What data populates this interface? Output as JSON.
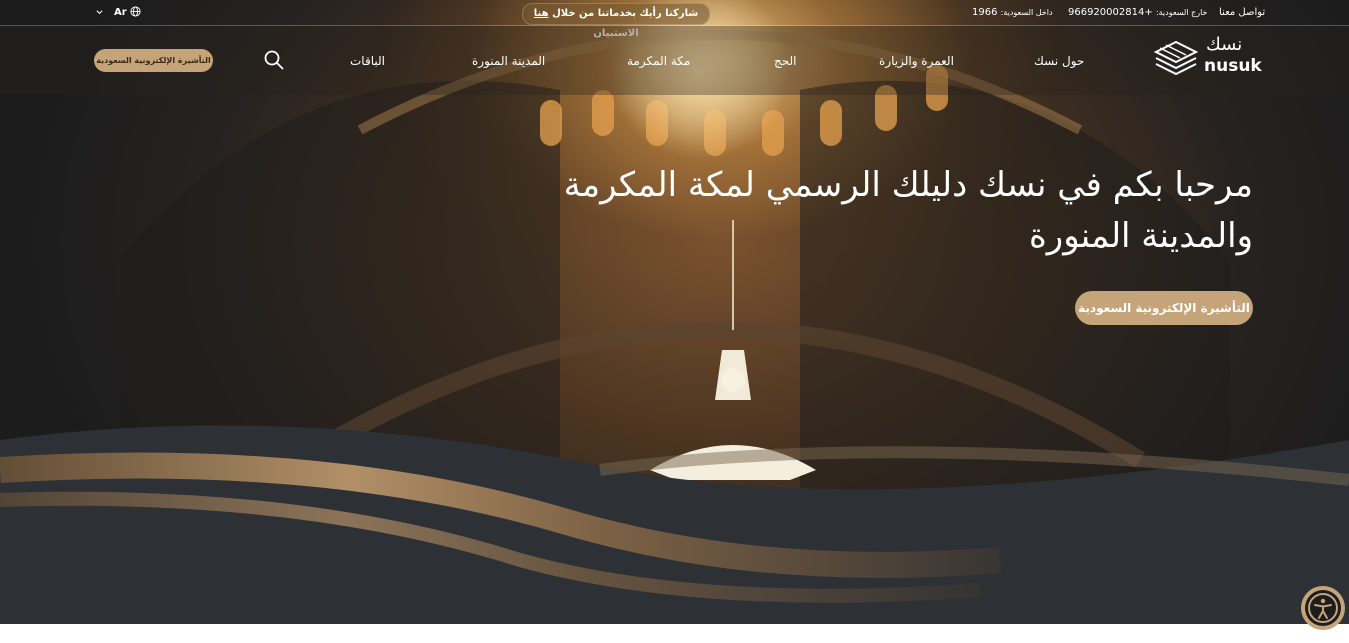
{
  "topbar": {
    "contact": "تواصل معنا",
    "outside_label": "خارج السعودية:",
    "outside_number": "+966920002814",
    "inside_label": "داخل السعودية:",
    "inside_number": "1966",
    "feedback_pre": "شاركنا رأيك بخدماتنا من خلال",
    "feedback_link": "هنا",
    "feedback_post": "الاستبيان",
    "language": "Ar",
    "icons": {
      "globe": "globe-icon",
      "chevron": "chevron-down-icon"
    }
  },
  "nav": {
    "logo_ar": "نسك",
    "logo_en": "nusuk",
    "items": [
      "حول نسك",
      "العمرة والزيارة",
      "الحج",
      "مكة المكرمة",
      "المدينة المنورة",
      "الباقات"
    ],
    "search_icon": "search-icon",
    "visa_button": "التأشيرة الإلكترونية السعودية"
  },
  "hero": {
    "title_line1": "مرحبا بكم في نسك دليلك الرسمي لمكة المكرمة",
    "title_line2": "والمدينة المنورة",
    "cta": "التأشيرة الإلكترونية السعودية"
  },
  "accessibility": {
    "icon": "accessibility-icon"
  },
  "colors": {
    "accent": "#c6a47a",
    "dark": "#2d3135"
  }
}
